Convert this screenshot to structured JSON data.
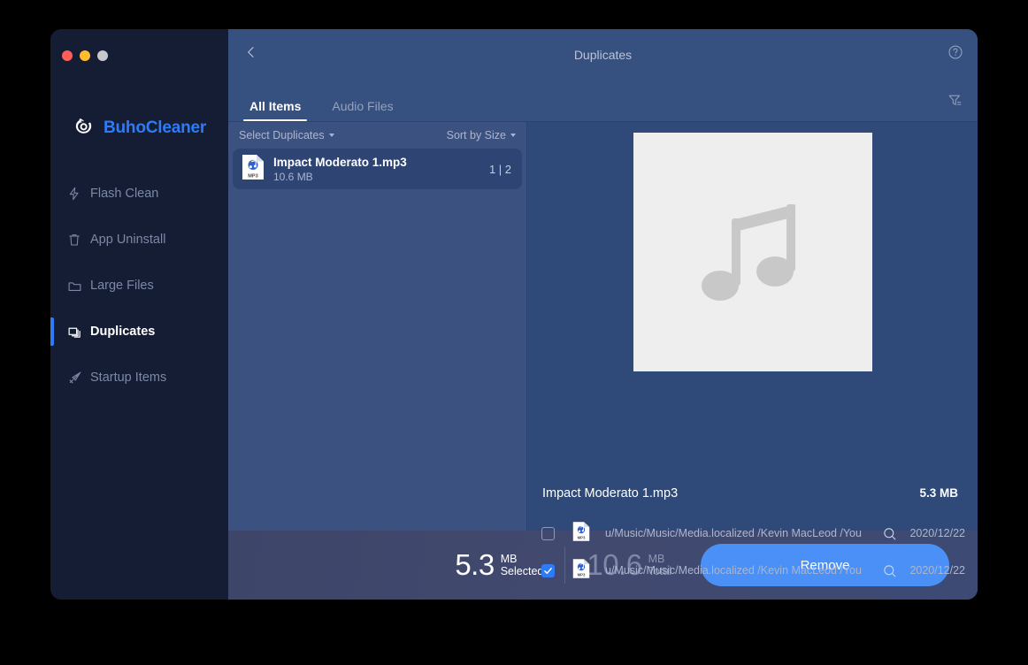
{
  "window": {
    "traffic_lights": [
      {
        "name": "close",
        "color": "#ff5f57"
      },
      {
        "name": "minimize",
        "color": "#febc2e"
      },
      {
        "name": "zoom",
        "color": "#c6c9cc"
      }
    ]
  },
  "sidebar": {
    "brand": "BuhoCleaner",
    "brand_color": "#2f7bf6",
    "items": [
      {
        "label": "Flash Clean",
        "icon": "bolt-icon",
        "active": false
      },
      {
        "label": "App Uninstall",
        "icon": "trash-icon",
        "active": false
      },
      {
        "label": "Large Files",
        "icon": "folder-icon",
        "active": false
      },
      {
        "label": "Duplicates",
        "icon": "duplicates-icon",
        "active": true
      },
      {
        "label": "Startup Items",
        "icon": "rocket-icon",
        "active": false
      }
    ]
  },
  "header": {
    "title": "Duplicates",
    "back_icon": "chevron-left-icon",
    "help_icon": "help-circle-icon",
    "filter_icon": "filter-icon"
  },
  "tabs": [
    {
      "label": "All Items",
      "active": true
    },
    {
      "label": "Audio Files",
      "active": false
    }
  ],
  "list_panel": {
    "select_duplicates_label": "Select Duplicates",
    "sort_label": "Sort by Size",
    "rows": [
      {
        "name": "Impact Moderato 1.mp3",
        "size": "10.6 MB",
        "count": "1 | 2",
        "icon": "mp3-file-icon",
        "selected": true
      }
    ]
  },
  "detail_panel": {
    "preview_icon": "music-note-icon",
    "filename": "Impact Moderato 1.mp3",
    "filesize": "5.3 MB",
    "files": [
      {
        "checked": false,
        "icon": "mp3-file-icon",
        "path": "u/Music/Music/Media.localized /Kevin MacLeod /You",
        "reveal_icon": "magnifier-icon",
        "date": "2020/12/22"
      },
      {
        "checked": true,
        "icon": "mp3-file-icon",
        "path": "u/Music/Music/Media.localized /Kevin MacLeod /You",
        "reveal_icon": "magnifier-icon",
        "date": "2020/12/22"
      }
    ]
  },
  "bottom_bar": {
    "selected_value": "5.3",
    "selected_unit": "MB",
    "selected_label": "Selected",
    "total_value": "10.6",
    "total_unit": "MB",
    "total_label": "Total",
    "remove_button": "Remove",
    "remove_color": "#4a90f7"
  }
}
